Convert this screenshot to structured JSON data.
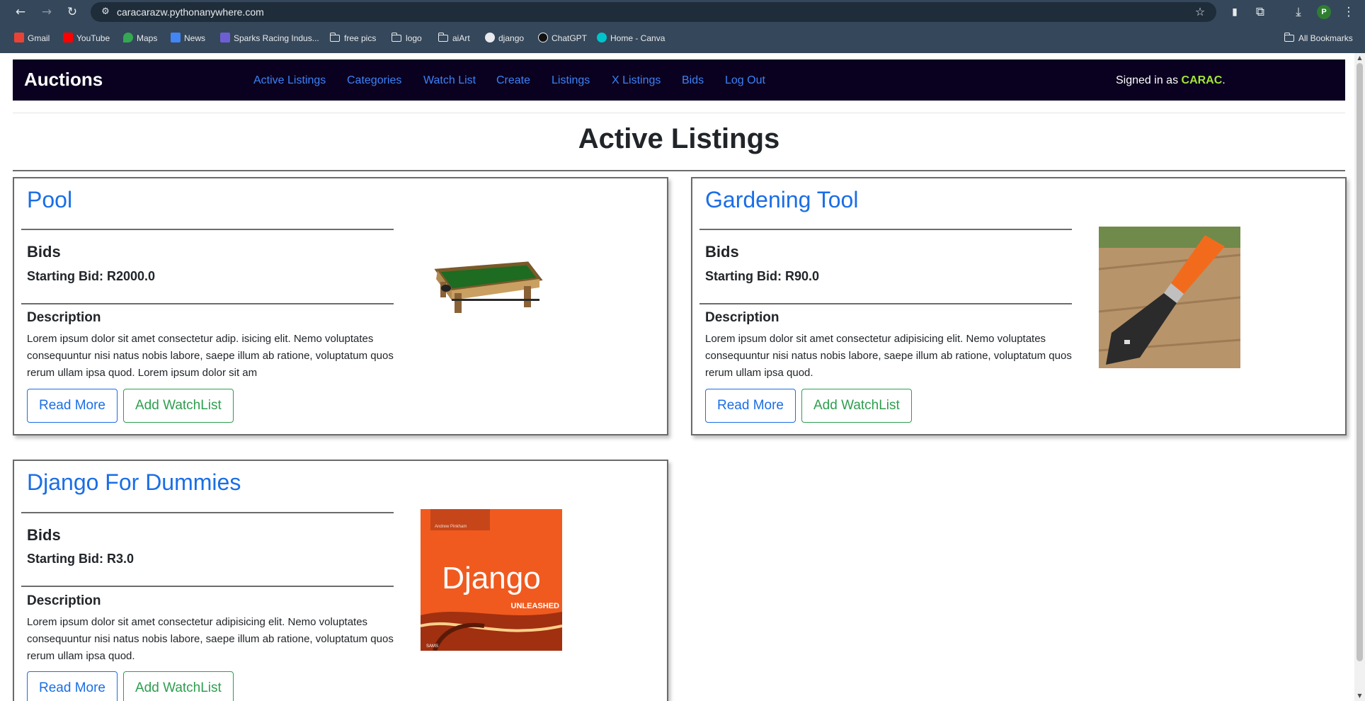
{
  "browser": {
    "url": "caracarazw.pythonanywhere.com",
    "profile_initial": "P",
    "bookmarks": [
      {
        "label": "Gmail",
        "icon": "gmail-icon"
      },
      {
        "label": "YouTube",
        "icon": "youtube-icon"
      },
      {
        "label": "Maps",
        "icon": "maps-icon"
      },
      {
        "label": "News",
        "icon": "news-icon"
      },
      {
        "label": "Sparks Racing Indus...",
        "icon": "sparks-icon"
      },
      {
        "label": "free pics",
        "icon": "folder-icon"
      },
      {
        "label": "logo",
        "icon": "folder-icon"
      },
      {
        "label": "aiArt",
        "icon": "folder-icon"
      },
      {
        "label": "django",
        "icon": "globe-icon"
      },
      {
        "label": "ChatGPT",
        "icon": "chatgpt-icon"
      },
      {
        "label": "Home - Canva",
        "icon": "canva-icon"
      }
    ],
    "all_bookmarks": "All Bookmarks"
  },
  "nav": {
    "brand": "Auctions",
    "links": [
      "Active Listings",
      "Categories",
      "Watch List",
      "Create",
      "Listings",
      "X Listings",
      "Bids",
      "Log Out"
    ],
    "signed_prefix": "Signed in as ",
    "username": "CARAC",
    "signed_suffix": "."
  },
  "page": {
    "title": "Active Listings"
  },
  "listings": [
    {
      "title": "Pool",
      "bids_label": "Bids",
      "starting_bid": "Starting Bid: R2000.0",
      "description_label": "Description",
      "description": "Lorem ipsum dolor sit amet consectetur adip. isicing elit. Nemo voluptates consequuntur nisi natus nobis labore, saepe illum ab ratione, voluptatum quos rerum ullam ipsa quod. Lorem ipsum dolor sit am",
      "read_more": "Read More",
      "add_watchlist": "Add WatchList"
    },
    {
      "title": "Gardening Tool",
      "bids_label": "Bids",
      "starting_bid": "Starting Bid: R90.0",
      "description_label": "Description",
      "description": "Lorem ipsum dolor sit amet consectetur adipisicing elit. Nemo voluptates consequuntur nisi natus nobis labore, saepe illum ab ratione, voluptatum quos rerum ullam ipsa quod.",
      "read_more": "Read More",
      "add_watchlist": "Add WatchList"
    },
    {
      "title": "Django For Dummies",
      "bids_label": "Bids",
      "starting_bid": "Starting Bid: R3.0",
      "description_label": "Description",
      "description": "Lorem ipsum dolor sit amet consectetur adipisicing elit. Nemo voluptates consequuntur nisi natus nobis labore, saepe illum ab ratione, voluptatum quos rerum ullam ipsa quod.",
      "read_more": "Read More",
      "add_watchlist": "Add WatchList",
      "book_author": "Andrew Pinkham",
      "book_title": "Django",
      "book_subtitle": "UNLEASHED",
      "book_publisher": "SAMS"
    }
  ]
}
